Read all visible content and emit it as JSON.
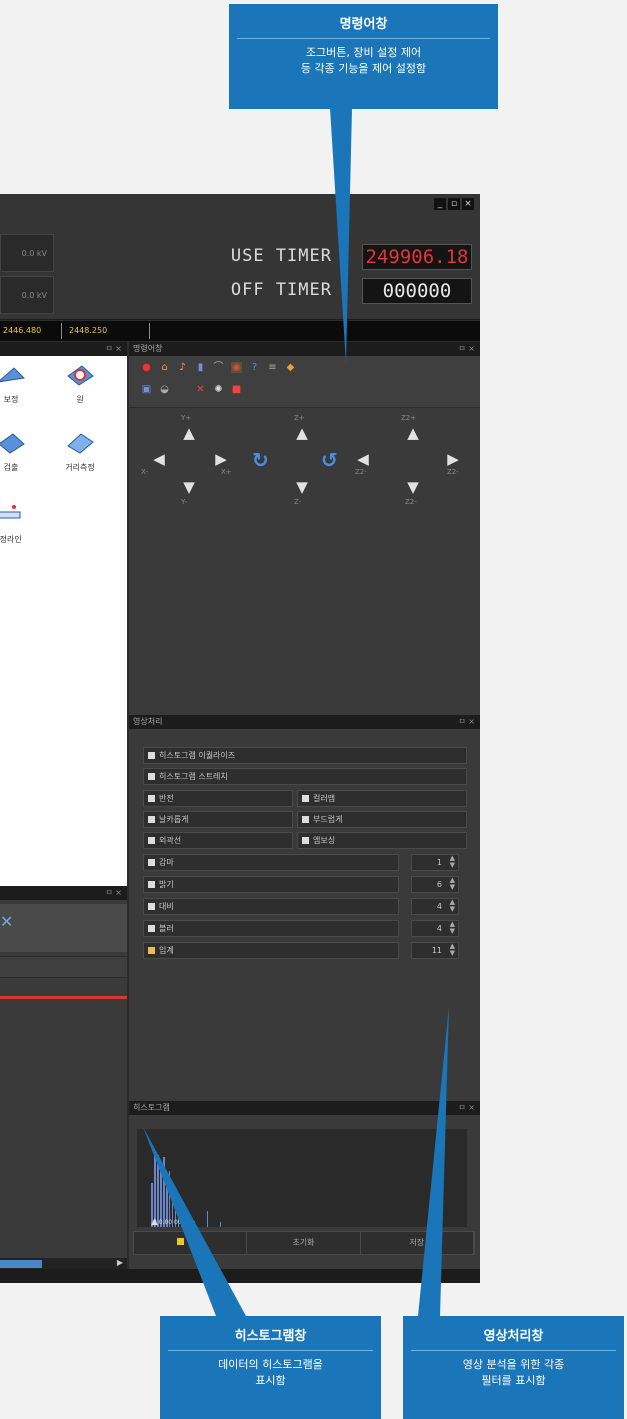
{
  "callouts": {
    "command": {
      "title": "명령어창",
      "desc1": "조그버튼, 장비 설정 제어",
      "desc2": "등 각종 기능을 제어 설정함"
    },
    "histogram": {
      "title": "히스토그램창",
      "desc1": "데이터의 히스토그램을",
      "desc2": "표시함"
    },
    "imageproc": {
      "title": "영상처리창",
      "desc1": "영상 분석을 위한 각종",
      "desc2": "필터를 표시함"
    }
  },
  "window": {
    "minimize": "_",
    "restore": "▫",
    "close": "×"
  },
  "volume": {
    "v1": "0.0 kV",
    "v2": "0.0 kV"
  },
  "timers": {
    "use_label": "USE TIMER",
    "use_value": "249906.18",
    "off_label": "OFF TIMER",
    "off_value": "000000"
  },
  "status": {
    "s1": "2446.480",
    "s2": "2448.250"
  },
  "gallery": {
    "items": [
      {
        "label": "보정"
      },
      {
        "label": "원"
      },
      {
        "label": "검출"
      },
      {
        "label": "거리측정"
      },
      {
        "label": "측정라인"
      }
    ]
  },
  "panels": {
    "command": {
      "title": "명령어창",
      "close": "ㅁ ×"
    },
    "imageproc": {
      "title": "영상처리",
      "close": "ㅁ ×"
    },
    "histogram": {
      "title": "히스토그램",
      "close": "ㅁ ×"
    },
    "left_lower": {
      "close": "ㅁ ×"
    }
  },
  "jog": {
    "x_plus": "X+",
    "x_minus": "X-",
    "y_plus": "Y+",
    "y_minus": "Y-",
    "z_plus": "Z+",
    "z_minus": "Z-",
    "z2_plus": "Z2+",
    "z2_minus": "Z2-"
  },
  "imageproc": {
    "rows": [
      {
        "label": "히스토그램 이퀄라이즈"
      },
      {
        "label": "히스토그램 스트레치"
      }
    ],
    "pairs": [
      {
        "left": "반전",
        "right": "컬러맵"
      },
      {
        "left": "날카롭게",
        "right": "부드럽게"
      },
      {
        "left": "외곽선",
        "right": "엠보싱"
      }
    ],
    "sliders": [
      {
        "label": "감마",
        "value": "1"
      },
      {
        "label": "밝기",
        "value": "6"
      },
      {
        "label": "대비",
        "value": "4"
      },
      {
        "label": "블러",
        "value": "4"
      },
      {
        "label": "임계",
        "value": "11"
      }
    ]
  },
  "histogram": {
    "bars": [
      0.55,
      0.95,
      0.9,
      0.8,
      0.88,
      0.6,
      0.7,
      0.4,
      0.25,
      0.15,
      0.1,
      0.08,
      0.2,
      0.06
    ],
    "marker_label": "0 0.00 000",
    "buttons": [
      "적용",
      "초기화",
      "저장"
    ]
  },
  "colors": {
    "accent_blue": "#1a76b8",
    "timer_red": "#e23535",
    "status_yellow": "#e9c53a"
  }
}
